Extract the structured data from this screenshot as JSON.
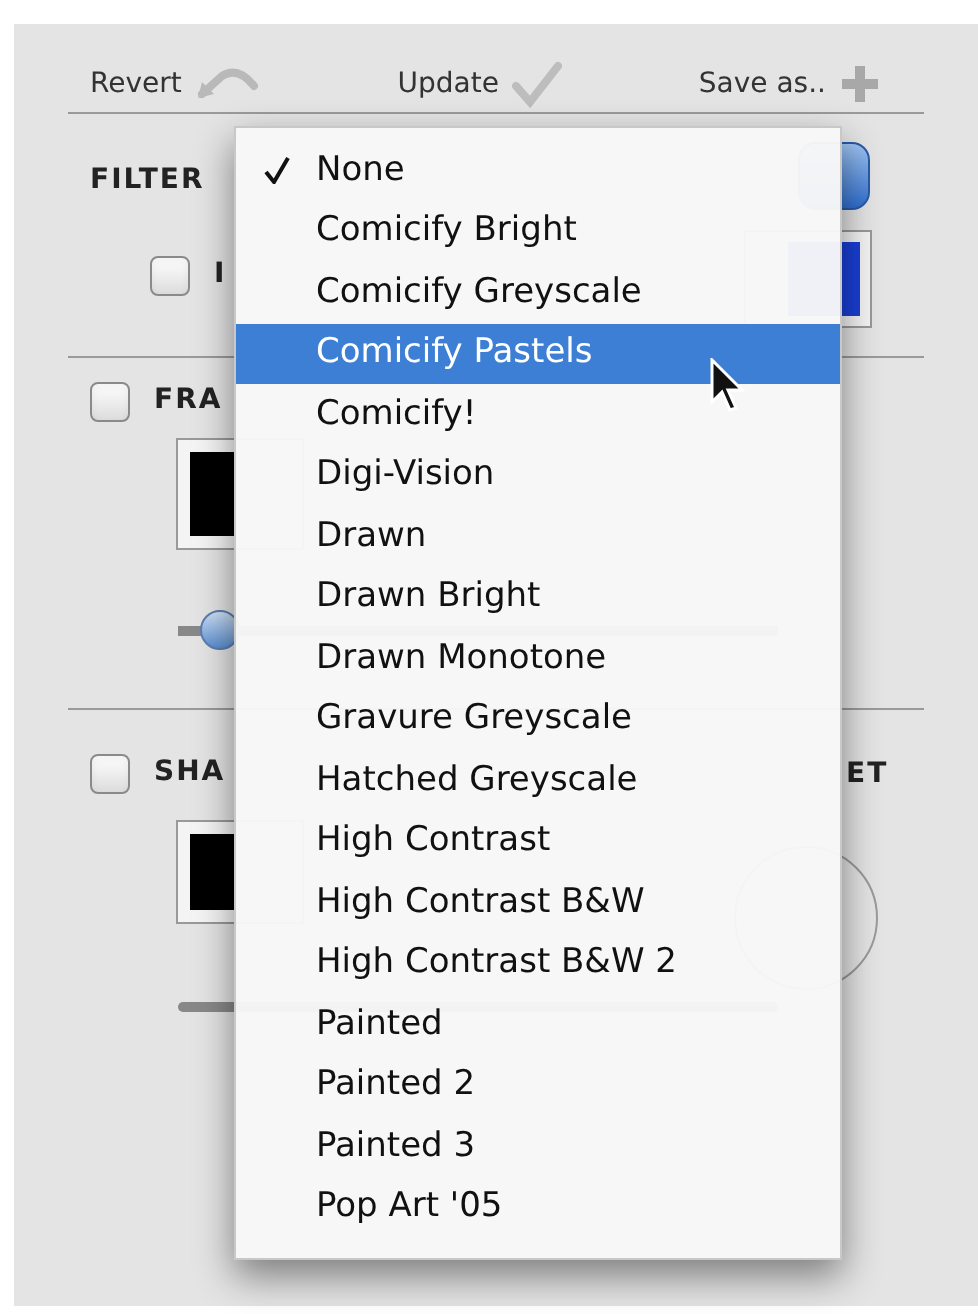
{
  "toolbar": [
    {
      "label": "Revert",
      "kind": "revert"
    },
    {
      "label": "Update",
      "kind": "update"
    },
    {
      "label": "Save as..",
      "kind": "save"
    }
  ],
  "filter": {
    "label": "FILTER",
    "invert": {
      "label": "I",
      "checked": false
    }
  },
  "frame": {
    "label": "FRA",
    "checked": false,
    "width_slider": {
      "level": 0.07
    }
  },
  "shadow": {
    "label": "SHA",
    "checked": false,
    "offset_label": "ET"
  },
  "menu": {
    "items": [
      {
        "label": "None",
        "checked": true,
        "selected": false
      },
      {
        "label": "Comicify Bright",
        "checked": false,
        "selected": false
      },
      {
        "label": "Comicify Greyscale",
        "checked": false,
        "selected": false
      },
      {
        "label": "Comicify Pastels",
        "checked": false,
        "selected": true
      },
      {
        "label": "Comicify!",
        "checked": false,
        "selected": false
      },
      {
        "label": "Digi-Vision",
        "checked": false,
        "selected": false
      },
      {
        "label": "Drawn",
        "checked": false,
        "selected": false
      },
      {
        "label": "Drawn Bright",
        "checked": false,
        "selected": false
      },
      {
        "label": "Drawn Monotone",
        "checked": false,
        "selected": false
      },
      {
        "label": "Gravure Greyscale",
        "checked": false,
        "selected": false
      },
      {
        "label": "Hatched Greyscale",
        "checked": false,
        "selected": false
      },
      {
        "label": "High Contrast",
        "checked": false,
        "selected": false
      },
      {
        "label": "High Contrast B&W",
        "checked": false,
        "selected": false
      },
      {
        "label": "High Contrast B&W 2",
        "checked": false,
        "selected": false
      },
      {
        "label": "Painted",
        "checked": false,
        "selected": false
      },
      {
        "label": "Painted 2",
        "checked": false,
        "selected": false
      },
      {
        "label": "Painted 3",
        "checked": false,
        "selected": false
      },
      {
        "label": "Pop Art '05",
        "checked": false,
        "selected": false
      }
    ]
  }
}
